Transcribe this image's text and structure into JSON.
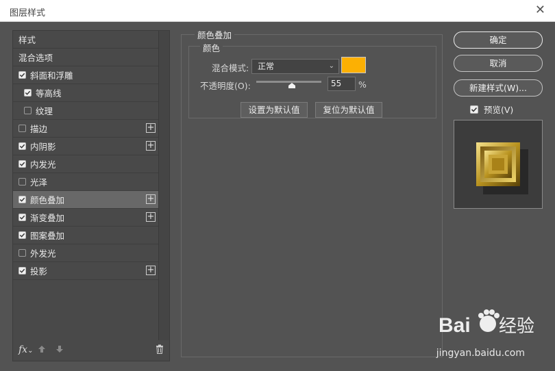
{
  "window": {
    "title": "图层样式",
    "close_label": "✕"
  },
  "style_list": {
    "items": [
      {
        "label": "样式",
        "checkbox": null,
        "plus": false,
        "indent": 0,
        "selected": false
      },
      {
        "label": "混合选项",
        "checkbox": null,
        "plus": false,
        "indent": 0,
        "selected": false
      },
      {
        "label": "斜面和浮雕",
        "checkbox": true,
        "plus": false,
        "indent": 0,
        "selected": false
      },
      {
        "label": "等高线",
        "checkbox": true,
        "plus": false,
        "indent": 1,
        "selected": false
      },
      {
        "label": "纹理",
        "checkbox": false,
        "plus": false,
        "indent": 1,
        "selected": false
      },
      {
        "label": "描边",
        "checkbox": false,
        "plus": true,
        "indent": 0,
        "selected": false
      },
      {
        "label": "内阴影",
        "checkbox": true,
        "plus": true,
        "indent": 0,
        "selected": false
      },
      {
        "label": "内发光",
        "checkbox": true,
        "plus": false,
        "indent": 0,
        "selected": false
      },
      {
        "label": "光泽",
        "checkbox": false,
        "plus": false,
        "indent": 0,
        "selected": false
      },
      {
        "label": "颜色叠加",
        "checkbox": true,
        "plus": true,
        "indent": 0,
        "selected": true
      },
      {
        "label": "渐变叠加",
        "checkbox": true,
        "plus": true,
        "indent": 0,
        "selected": false
      },
      {
        "label": "图案叠加",
        "checkbox": true,
        "plus": false,
        "indent": 0,
        "selected": false
      },
      {
        "label": "外发光",
        "checkbox": false,
        "plus": false,
        "indent": 0,
        "selected": false
      },
      {
        "label": "投影",
        "checkbox": true,
        "plus": true,
        "indent": 0,
        "selected": false
      }
    ],
    "footer": {
      "fx_label": "fx",
      "fx_suffix": "⌄"
    }
  },
  "color_overlay": {
    "group_title": "颜色叠加",
    "sub_title": "颜色",
    "blend_mode_label": "混合模式:",
    "blend_mode_value": "正常",
    "color_value": "#fcb003",
    "opacity_label": "不透明度(O):",
    "opacity_value": "55",
    "opacity_fraction": 0.55,
    "opacity_unit": "%",
    "make_default_label": "设置为默认值",
    "reset_default_label": "复位为默认值"
  },
  "actions": {
    "ok_label": "确定",
    "cancel_label": "取消",
    "new_style_label": "新建样式(W)...",
    "preview_label": "预览(V)",
    "preview_checked": true
  },
  "watermark": {
    "brand": "Baidu经验",
    "url": "jingyan.baidu.com"
  }
}
